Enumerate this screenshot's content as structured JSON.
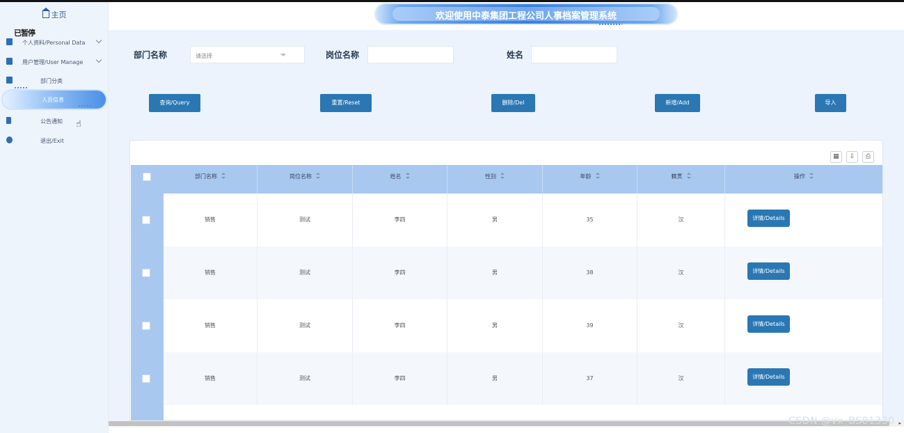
{
  "header": {
    "title": "欢迎使用中泰集团工程公司人事档案管理系统"
  },
  "sidebar": {
    "home_label": "主页",
    "ghost_text": "已暂停",
    "items": [
      {
        "label": "个人资料/Personal Data",
        "icon": "person-icon",
        "expandable": true
      },
      {
        "label": "用户管理/User Manage",
        "icon": "user-manage-icon",
        "expandable": true
      },
      {
        "label": "部门分类",
        "icon": "department-icon"
      },
      {
        "label": "人员信息",
        "icon": "staff-icon",
        "active": true
      },
      {
        "label": "公告通知",
        "icon": "bookmark-icon"
      },
      {
        "label": "退出/Exit",
        "icon": "exit-icon"
      }
    ]
  },
  "filters": {
    "department_label": "部门名称",
    "department_placeholder": "请选择",
    "position_label": "岗位名称",
    "position_value": "",
    "name_label": "姓名",
    "name_value": ""
  },
  "actions": {
    "query": "查询/Query",
    "reset": "重置/Reset",
    "delete": "删除/Del",
    "add": "新增/Add",
    "import": "导入"
  },
  "table": {
    "columns": [
      "部门名称",
      "岗位名称",
      "姓名",
      "性别",
      "年龄",
      "籍贯",
      "操作"
    ],
    "detail_label": "详情/Details",
    "rows": [
      {
        "department": "销售",
        "position": "测试",
        "name": "李四",
        "gender": "男",
        "age": "35",
        "origin": "汉"
      },
      {
        "department": "销售",
        "position": "测试",
        "name": "李四",
        "gender": "男",
        "age": "38",
        "origin": "汉"
      },
      {
        "department": "销售",
        "position": "测试",
        "name": "李四",
        "gender": "男",
        "age": "39",
        "origin": "汉"
      },
      {
        "department": "销售",
        "position": "测试",
        "name": "李四",
        "gender": "男",
        "age": "37",
        "origin": "汉"
      }
    ]
  },
  "watermark": "CSDN @vx_BS81330",
  "colors": {
    "primary_button": "#2a77b3",
    "header_row": "#a8c8f0",
    "sidebar_bg": "#eef4fc"
  }
}
